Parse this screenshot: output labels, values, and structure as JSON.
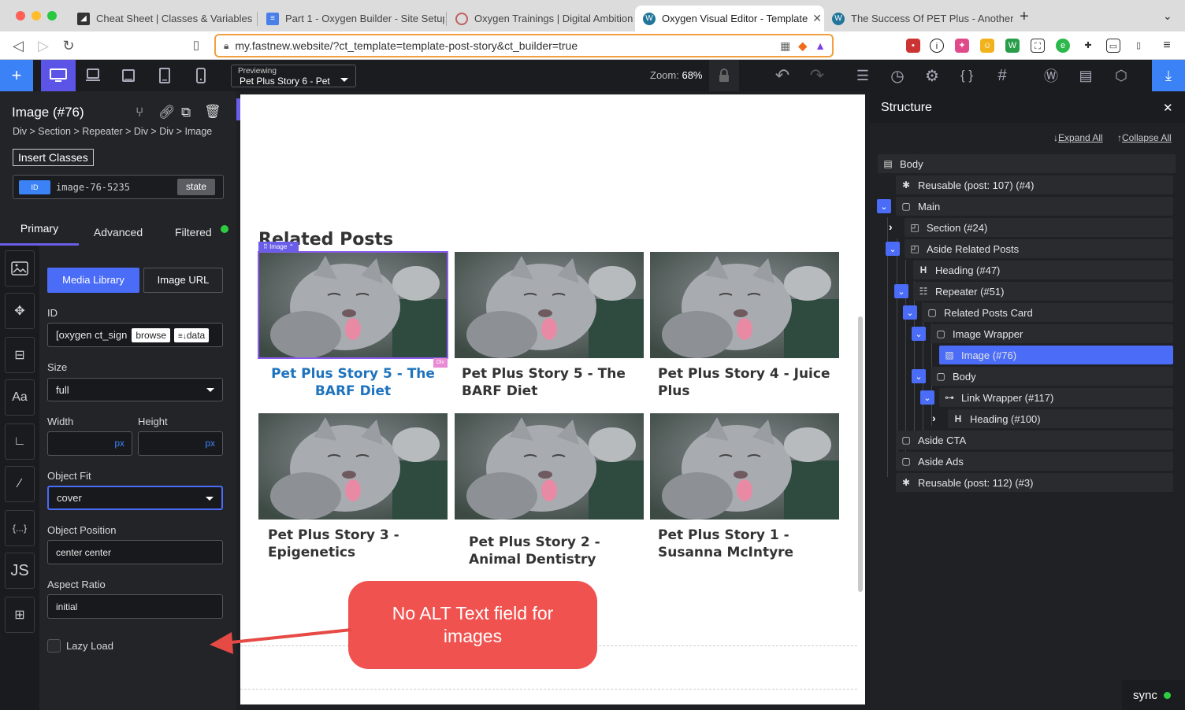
{
  "browser": {
    "tabs": [
      {
        "label": "Cheat Sheet | Classes & Variables |",
        "icon": "oxygen-icon"
      },
      {
        "label": "Part 1 - Oxygen Builder - Site Setup",
        "icon": "docs-icon"
      },
      {
        "label": "Oxygen Trainings | Digital Ambition",
        "icon": "circle-icon"
      },
      {
        "label": "Oxygen Visual Editor - Template",
        "icon": "wordpress-icon",
        "active": true
      },
      {
        "label": "The Success Of PET Plus - Another",
        "icon": "wordpress-icon"
      }
    ],
    "url": "my.fastnew.website/?ct_template=template-post-story&ct_builder=true"
  },
  "toolbar": {
    "previewing_label": "Previewing",
    "previewing_value": "Pet Plus Story 6 - Pet",
    "zoom_label": "Zoom:",
    "zoom_value": "68%"
  },
  "left_panel": {
    "title": "Image (#76)",
    "breadcrumb": "Div > Section > Repeater > Div > Div > Image",
    "insert_classes": "Insert Classes",
    "id_tag": "ID",
    "id_value": "image-76-5235",
    "state_label": "state",
    "tabs": [
      "Primary",
      "Advanced",
      "Filtered"
    ],
    "media_library": "Media Library",
    "image_url": "Image URL",
    "id_label": "ID",
    "id_field_value": "[oxygen ct_sign",
    "browse": "browse",
    "data": "data",
    "size_label": "Size",
    "size_value": "full",
    "width_label": "Width",
    "height_label": "Height",
    "px": "px",
    "object_fit_label": "Object Fit",
    "object_fit_value": "cover",
    "object_position_label": "Object Position",
    "object_position_value": "center center",
    "aspect_ratio_label": "Aspect Ratio",
    "aspect_ratio_value": "initial",
    "lazy_load_label": "Lazy Load",
    "icon_js": "JS",
    "icon_aa": "Aa",
    "icon_braces": "{...}"
  },
  "canvas": {
    "section_heading": "Related Posts",
    "image_tag": "Image",
    "div_tag": "Div",
    "cards": [
      {
        "title": "Pet Plus Story 5 - The BARF Diet",
        "selected": true
      },
      {
        "title": "Pet Plus Story 5 - The BARF Diet"
      },
      {
        "title": "Pet Plus Story 4 - Juice Plus"
      },
      {
        "title": "Pet Plus Story 3 - Epigenetics"
      },
      {
        "title": "Pet Plus Story 2 - Animal Dentistry"
      },
      {
        "title": "Pet Plus Story 1 - Susanna McIntyre"
      }
    ],
    "callout": "No ALT Text field for images",
    "callout_color": "#f0524f",
    "link_color": "#1e73be"
  },
  "structure": {
    "title": "Structure",
    "expand_all": "Expand All",
    "collapse_all": "Collapse All",
    "nodes": [
      {
        "label": "Body",
        "icon": "body-icon"
      },
      {
        "label": "Reusable (post: 107) (#4)",
        "icon": "star-icon"
      },
      {
        "label": "Main",
        "icon": "box-icon"
      },
      {
        "label": "Section (#24)",
        "icon": "section-icon"
      },
      {
        "label": "Aside Related Posts",
        "icon": "section-icon"
      },
      {
        "label": "Heading (#47)",
        "icon": "heading-icon"
      },
      {
        "label": "Repeater (#51)",
        "icon": "repeater-icon"
      },
      {
        "label": "Related Posts Card",
        "icon": "box-icon"
      },
      {
        "label": "Image Wrapper",
        "icon": "box-icon"
      },
      {
        "label": "Image (#76)",
        "icon": "image-icon",
        "selected": true
      },
      {
        "label": "Body",
        "icon": "box-icon"
      },
      {
        "label": "Link Wrapper (#117)",
        "icon": "link-icon"
      },
      {
        "label": "Heading (#100)",
        "icon": "heading-icon"
      },
      {
        "label": "Aside CTA",
        "icon": "box-icon"
      },
      {
        "label": "Aside Ads",
        "icon": "box-icon"
      },
      {
        "label": "Reusable (post: 112) (#3)",
        "icon": "star-icon"
      }
    ]
  },
  "footer": {
    "sync": "sync"
  }
}
